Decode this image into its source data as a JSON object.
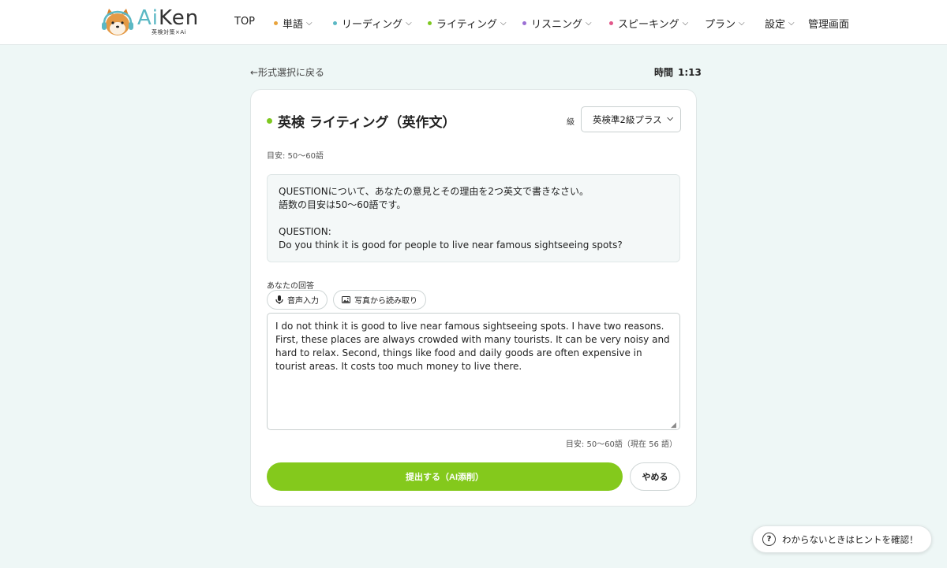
{
  "header": {
    "brand_ai": "Ai",
    "brand_ken": "Ken",
    "brand_tagline": "英検対策×Ai",
    "nav": [
      {
        "label": "TOP",
        "dot_color": "",
        "has_menu": false
      },
      {
        "label": "単語",
        "dot_color": "#e8a33c",
        "has_menu": true
      },
      {
        "label": "リーディング",
        "dot_color": "#5bb8c4",
        "has_menu": true
      },
      {
        "label": "ライティング",
        "dot_color": "#7ec820",
        "has_menu": true
      },
      {
        "label": "リスニング",
        "dot_color": "#9b6fd4",
        "has_menu": true
      },
      {
        "label": "スピーキング",
        "dot_color": "#e2578a",
        "has_menu": true
      },
      {
        "label": "プラン",
        "dot_color": "",
        "has_menu": true
      },
      {
        "label": "設定",
        "dot_color": "",
        "has_menu": true
      },
      {
        "label": "管理画面",
        "dot_color": "",
        "has_menu": false
      }
    ]
  },
  "top_bar": {
    "back_label": "←形式選択に戻る",
    "timer_label": "時間",
    "timer_value": "1:13"
  },
  "card": {
    "title": "英検 ライティング（英作文）",
    "grade_label": "級",
    "grade_selected": "英検準2級プラス",
    "guideline": "目安: 50〜60語",
    "question_lines": [
      "QUESTIONについて、あなたの意見とその理由を2つ英文で書きなさい。",
      "語数の目安は50〜60語です。",
      "",
      "QUESTION:",
      "Do you think it is good for people to live near famous sightseeing spots?"
    ],
    "answer_label": "あなたの回答",
    "voice_input_label": "音声入力",
    "photo_read_label": "写真から読み取り",
    "answer_text": "I do not think it is good to live near famous sightseeing spots. I have two reasons. First, these places are always crowded with many tourists. It can be very noisy and hard to relax. Second, things like food and daily goods are often expensive in tourist areas. It costs too much money to live there.",
    "wordcount": "目安: 50〜60語（現在 56 語）",
    "submit_label": "提出する（AI添削）",
    "cancel_label": "やめる"
  },
  "hint": {
    "label": "わからないときはヒントを確認！"
  },
  "colors": {
    "accent_green": "#84c91c",
    "page_bg": "#eef7f6"
  }
}
